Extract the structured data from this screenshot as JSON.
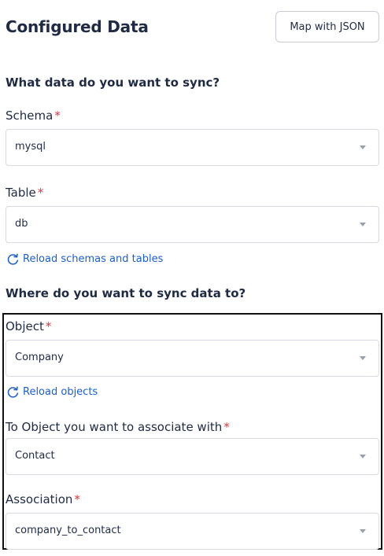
{
  "header": {
    "title": "Configured Data",
    "map_button_label": "Map with JSON"
  },
  "source": {
    "heading": "What data do you want to sync?",
    "schema": {
      "label": "Schema",
      "required_mark": "*",
      "value": "mysql"
    },
    "table": {
      "label": "Table",
      "required_mark": "*",
      "value": "db"
    },
    "reload_label": "Reload schemas and tables"
  },
  "destination": {
    "heading": "Where do you want to sync data to?",
    "object": {
      "label": "Object",
      "required_mark": "*",
      "value": "Company"
    },
    "reload_label": "Reload objects",
    "to_object": {
      "label": "To Object you want to associate with",
      "required_mark": "*",
      "value": "Contact"
    },
    "association": {
      "label": "Association",
      "required_mark": "*",
      "value": "company_to_contact"
    }
  },
  "colors": {
    "text": "#1f2a44",
    "required": "#e5313e",
    "link": "#1a5fd0",
    "border": "#d7dae0"
  },
  "icons": {
    "reload": "refresh-icon",
    "dropdown": "caret-down-icon"
  }
}
